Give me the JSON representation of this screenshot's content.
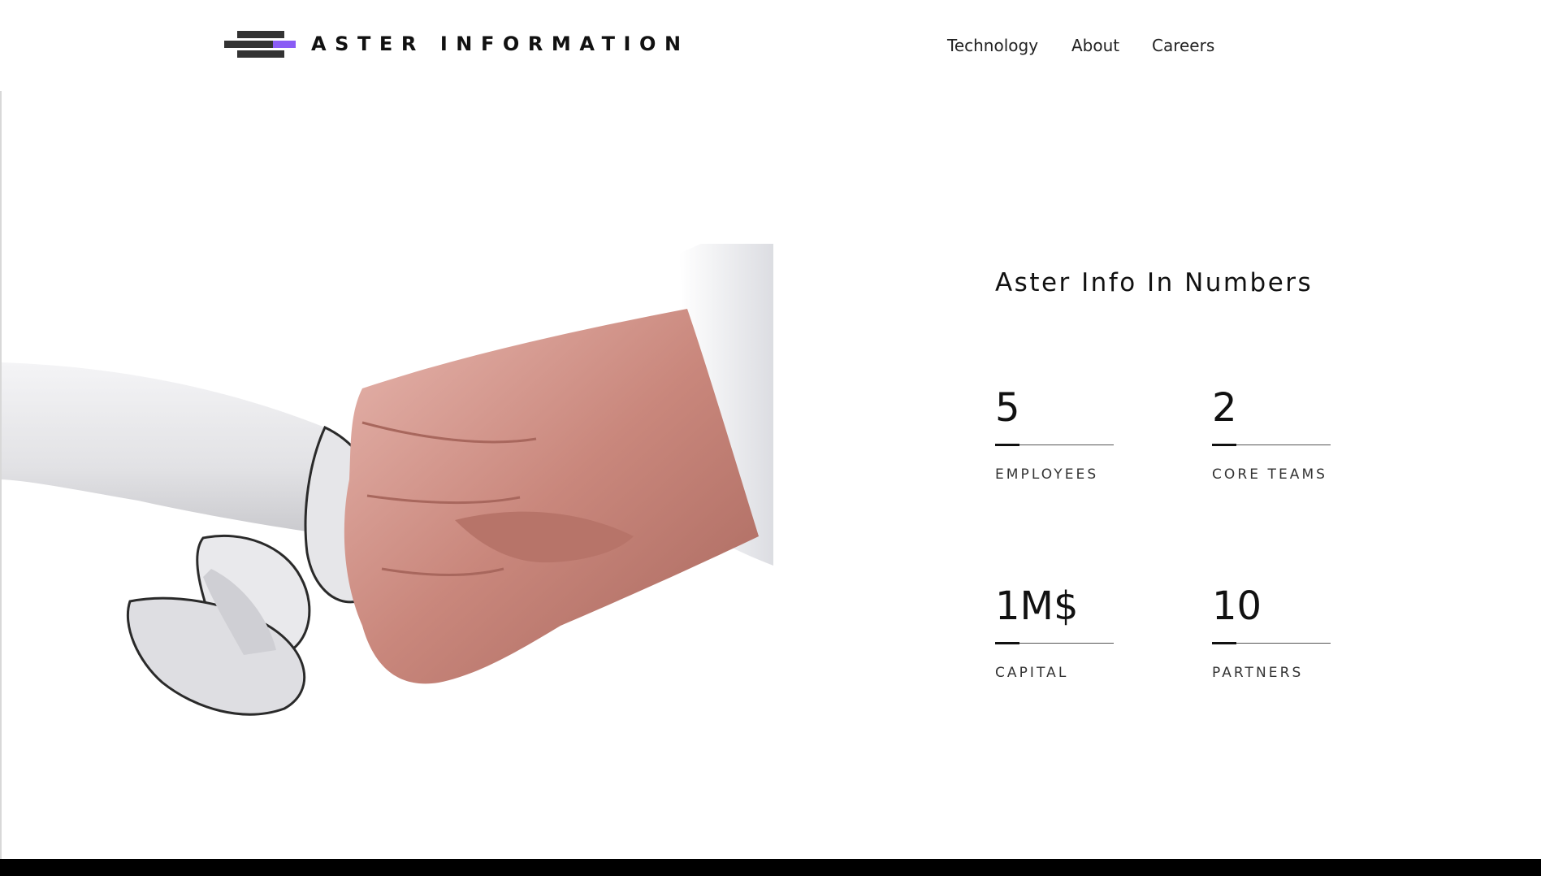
{
  "header": {
    "brand": "ASTER INFORMATION",
    "nav": [
      "Technology",
      "About",
      "Careers"
    ]
  },
  "stats": {
    "title": "Aster Info In Numbers",
    "items": [
      {
        "value": "5",
        "label": "EMPLOYEES"
      },
      {
        "value": "2",
        "label": "CORE TEAMS"
      },
      {
        "value": "1M$",
        "label": "CAPITAL"
      },
      {
        "value": "10",
        "label": "PARTNERS"
      }
    ]
  },
  "colors": {
    "logo_dark": "#333333",
    "logo_accent": "#8a5cf5",
    "text": "#111111",
    "footer": "#000000"
  },
  "hero_image": "robot-hand-fist-bump-human-hand"
}
